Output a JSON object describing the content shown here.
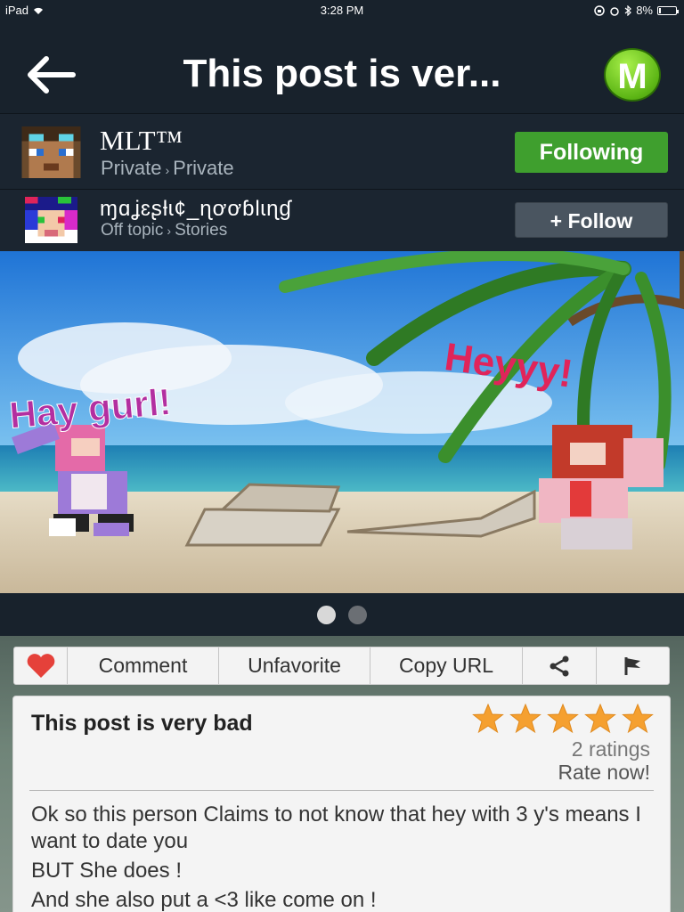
{
  "status_bar": {
    "device": "iPad",
    "time": "3:28 PM",
    "battery": "8%",
    "battery_level": 0.08
  },
  "nav": {
    "title": "This post is ver...",
    "logo_letter": "M"
  },
  "authors": [
    {
      "name": "MLT™",
      "category": "Private",
      "subcategory": "Private",
      "follow_label": "Following"
    },
    {
      "name": "ɱɑʝɛʂƚɩ¢_ɳơơɓƖɩɳɠ",
      "category": "Off topic",
      "subcategory": "Stories",
      "follow_label": "+ Follow"
    }
  ],
  "hero": {
    "caption_left": "Hay gurl!",
    "caption_right": "Heyyy!",
    "page_count": 2,
    "current_page": 1
  },
  "actions": {
    "comment": "Comment",
    "unfavorite": "Unfavorite",
    "copy_url": "Copy URL"
  },
  "post": {
    "title": "This post is very bad",
    "stars": 5,
    "ratings": "2 ratings",
    "rate_now": "Rate now!",
    "body": [
      "Ok so this person Claims to not know that hey with 3 y's means I want to date you",
      "BUT She does !",
      "And she also put a <3 like come on !"
    ]
  },
  "colors": {
    "following": "#3f9f2e",
    "follow": "#4a5560",
    "star": "#f5a030",
    "heart": "#e5413a",
    "logo": "#5cb515"
  }
}
